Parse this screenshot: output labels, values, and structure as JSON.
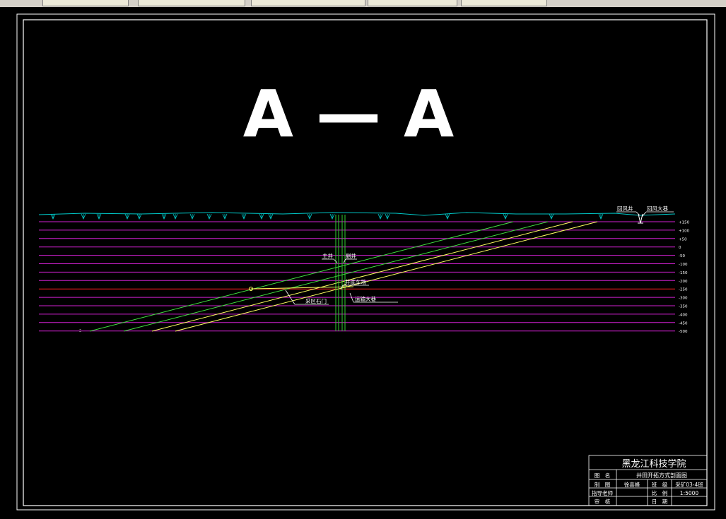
{
  "drawing": {
    "title": "A — A",
    "shaft_labels": {
      "main": "主井",
      "aux": "副井"
    },
    "labels": {
      "shaft_bottom": "井底车场",
      "transport_roadway": "运输大巷",
      "mining_stone_gate": "采区石门",
      "air_shaft": "回风井",
      "air_roadway": "回风大巷"
    },
    "levels": [
      "+150",
      "+100",
      "+50",
      "0",
      "-50",
      "-100",
      "-150",
      "-200",
      "-250",
      "-300",
      "-350",
      "-400",
      "-450",
      "-500"
    ],
    "colors": {
      "surface": "#00c8c8",
      "level": "#d020d0",
      "red_level": "#ff2020",
      "seam_green": "#40e040",
      "seam_yellow": "#ffff60",
      "shaft": "#30d030",
      "text": "#ffffff",
      "frame": "#ffffff"
    }
  },
  "title_block": {
    "school": "黑龙江科技学院",
    "drawing_name_label": "图　名",
    "drawing_name": "井田开拓方式剖面图",
    "drawn_by_label": "制　图",
    "drawn_by": "徐喜峰",
    "class_label": "班　级",
    "class": "采矿03-4班",
    "advisor_label": "指导老师",
    "advisor": "",
    "scale_label": "比　例",
    "scale": "1:5000",
    "reviewer_label": "审　核",
    "reviewer": "",
    "date_label": "日　期",
    "date": ""
  }
}
